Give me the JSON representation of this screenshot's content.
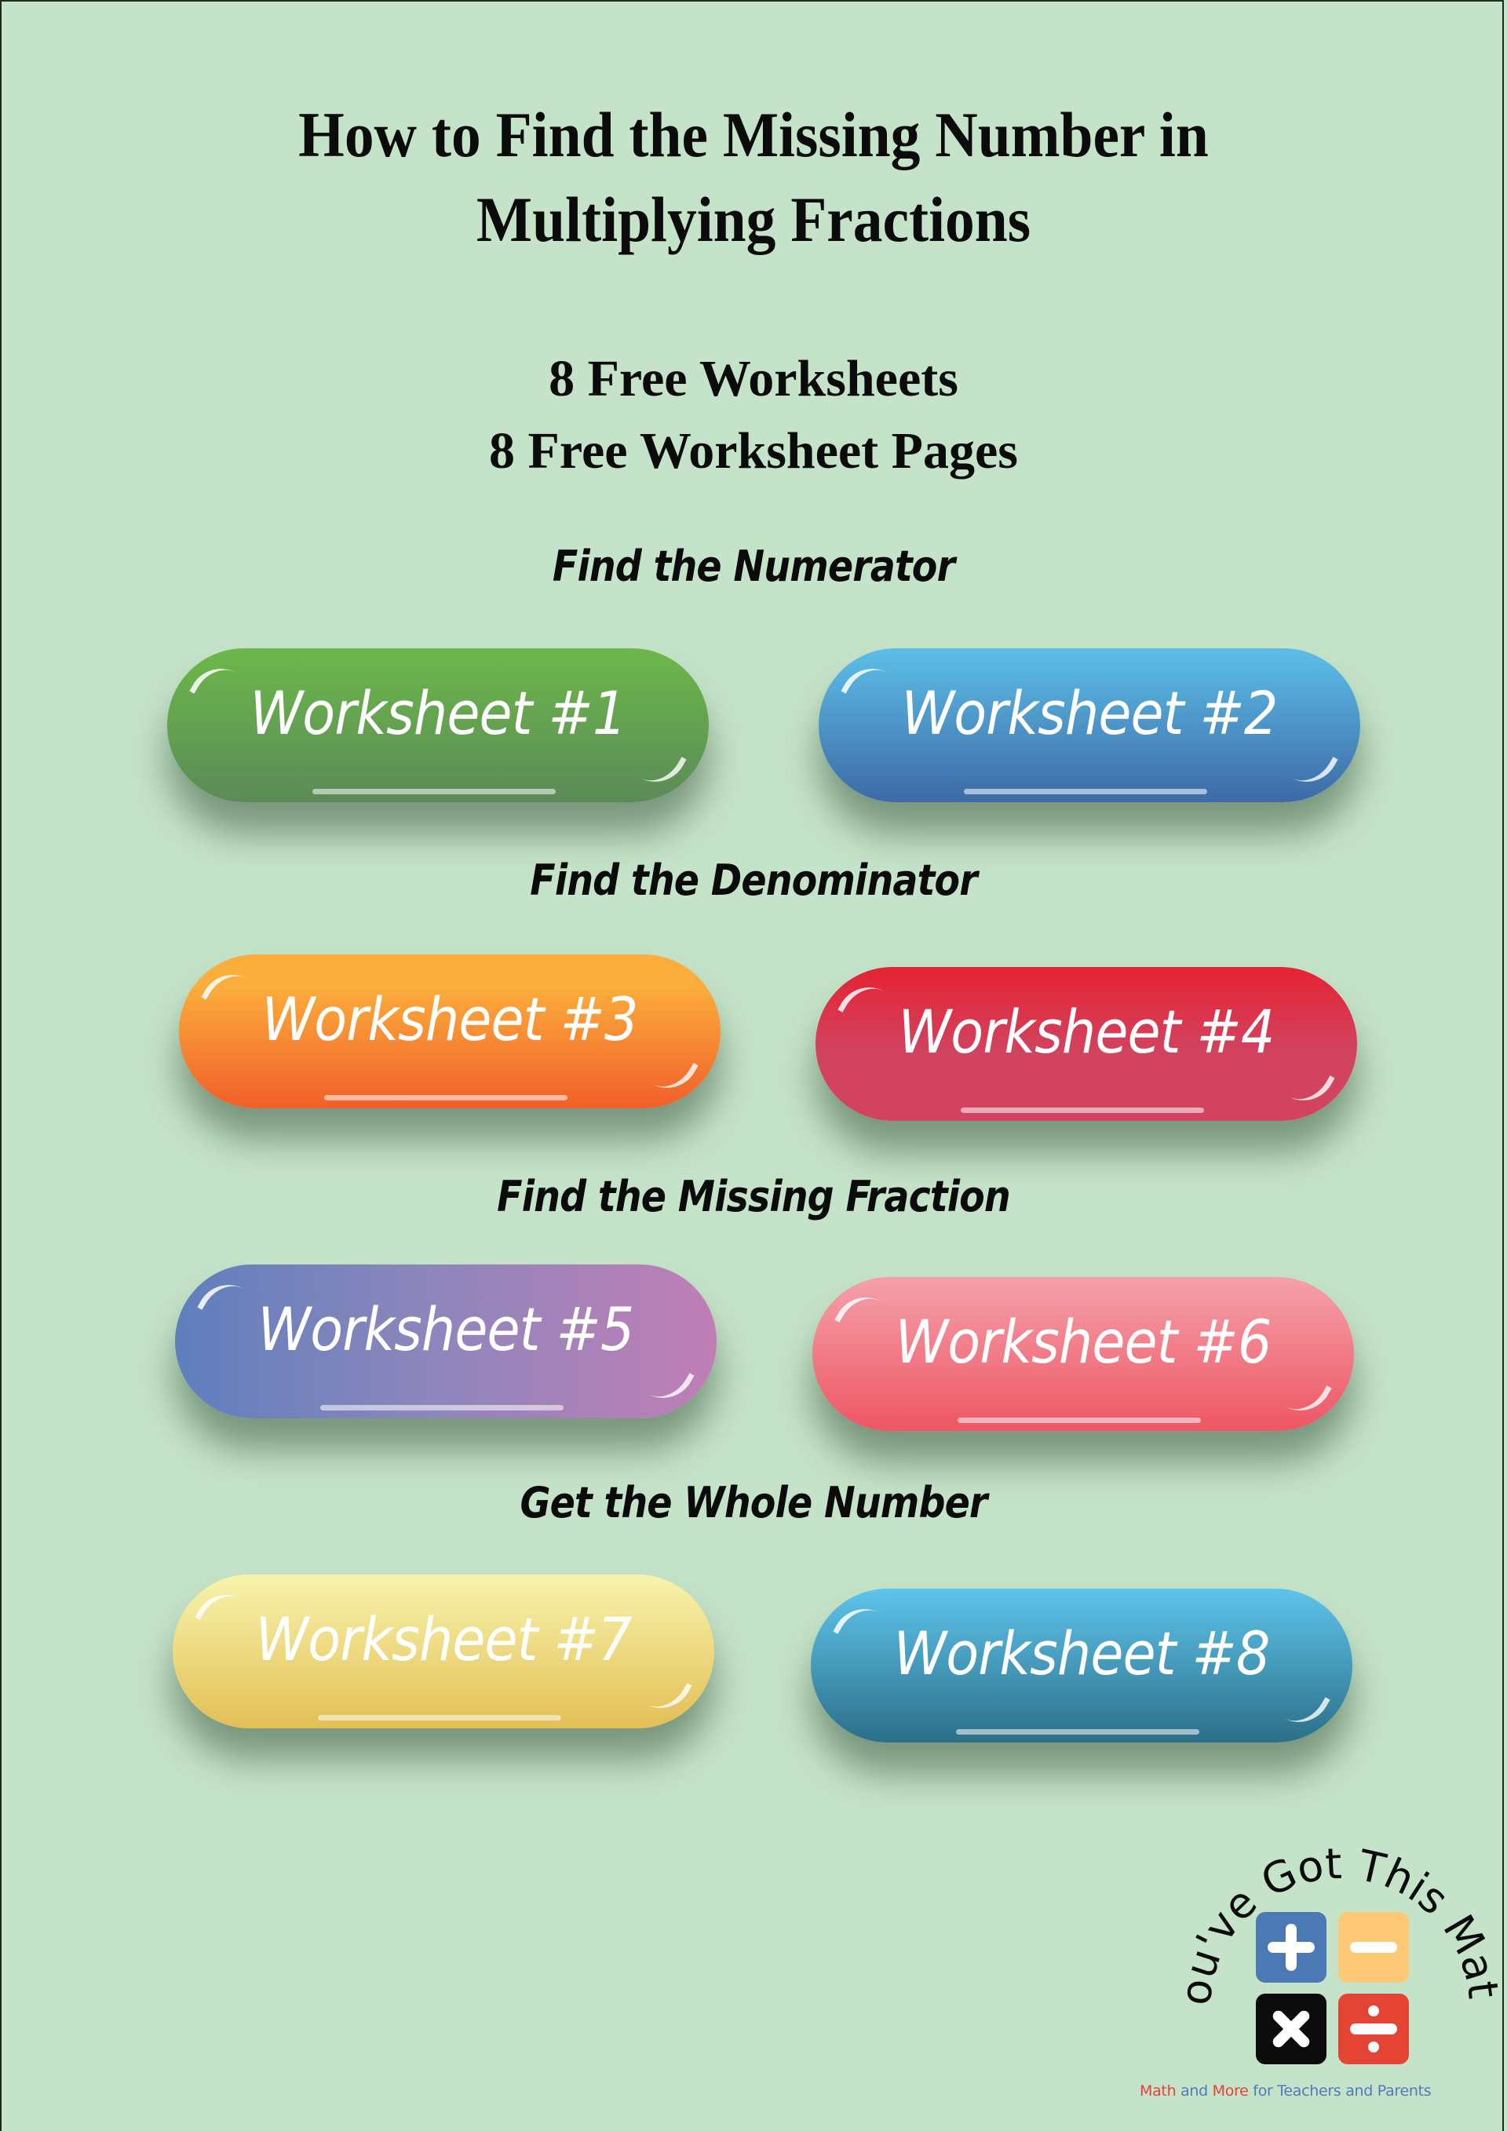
{
  "title": {
    "line1": "How to Find the Missing Number in",
    "line2": "Multiplying Fractions"
  },
  "subtitle": {
    "line1": "8 Free Worksheets",
    "line2": "8 Free Worksheet Pages"
  },
  "sections": [
    {
      "label": "Find the Numerator",
      "buttons": [
        {
          "label": "Worksheet #1",
          "color_top": "#6cb84a",
          "color_bottom": "#5b8b57"
        },
        {
          "label": "Worksheet #2",
          "color_top": "#5cbfe8",
          "color_bottom": "#3d6aa6"
        }
      ]
    },
    {
      "label": "Find the Denominator",
      "buttons": [
        {
          "label": "Worksheet #3",
          "color_top": "#fbae3c",
          "color_bottom": "#f15f29"
        },
        {
          "label": "Worksheet #4",
          "color_top": "#e52333",
          "color_bottom": "#d1435f"
        }
      ]
    },
    {
      "label": "Find the Missing Fraction",
      "buttons": [
        {
          "label": "Worksheet #5",
          "color_left": "#5f7fbd",
          "color_right": "#c07eb5"
        },
        {
          "label": "Worksheet #6",
          "color_top": "#f4a1ab",
          "color_bottom": "#ee5663"
        }
      ]
    },
    {
      "label": "Get the Whole Number",
      "buttons": [
        {
          "label": "Worksheet #7",
          "color_top": "#f8f4ae",
          "color_bottom": "#e3bf55"
        },
        {
          "label": "Worksheet #8",
          "color_top": "#5ec4ec",
          "color_bottom": "#2c6f88"
        }
      ]
    }
  ],
  "logo": {
    "arc_text": "You've Got This Math",
    "tiles": [
      {
        "symbol": "plus-icon",
        "color": "#4a79b4"
      },
      {
        "symbol": "minus-icon",
        "color": "#fdc976"
      },
      {
        "symbol": "times-icon",
        "color": "#0b0b0b"
      },
      {
        "symbol": "divide-icon",
        "color": "#e44434"
      }
    ],
    "tagline": [
      {
        "text": "Math",
        "color": "red"
      },
      {
        "text": " and ",
        "color": "blue"
      },
      {
        "text": "More",
        "color": "red"
      },
      {
        "text": " for Teachers and Parents",
        "color": "blue"
      }
    ]
  },
  "colors": {
    "background": "#c5e3c8",
    "text": "#0b0b0b"
  }
}
